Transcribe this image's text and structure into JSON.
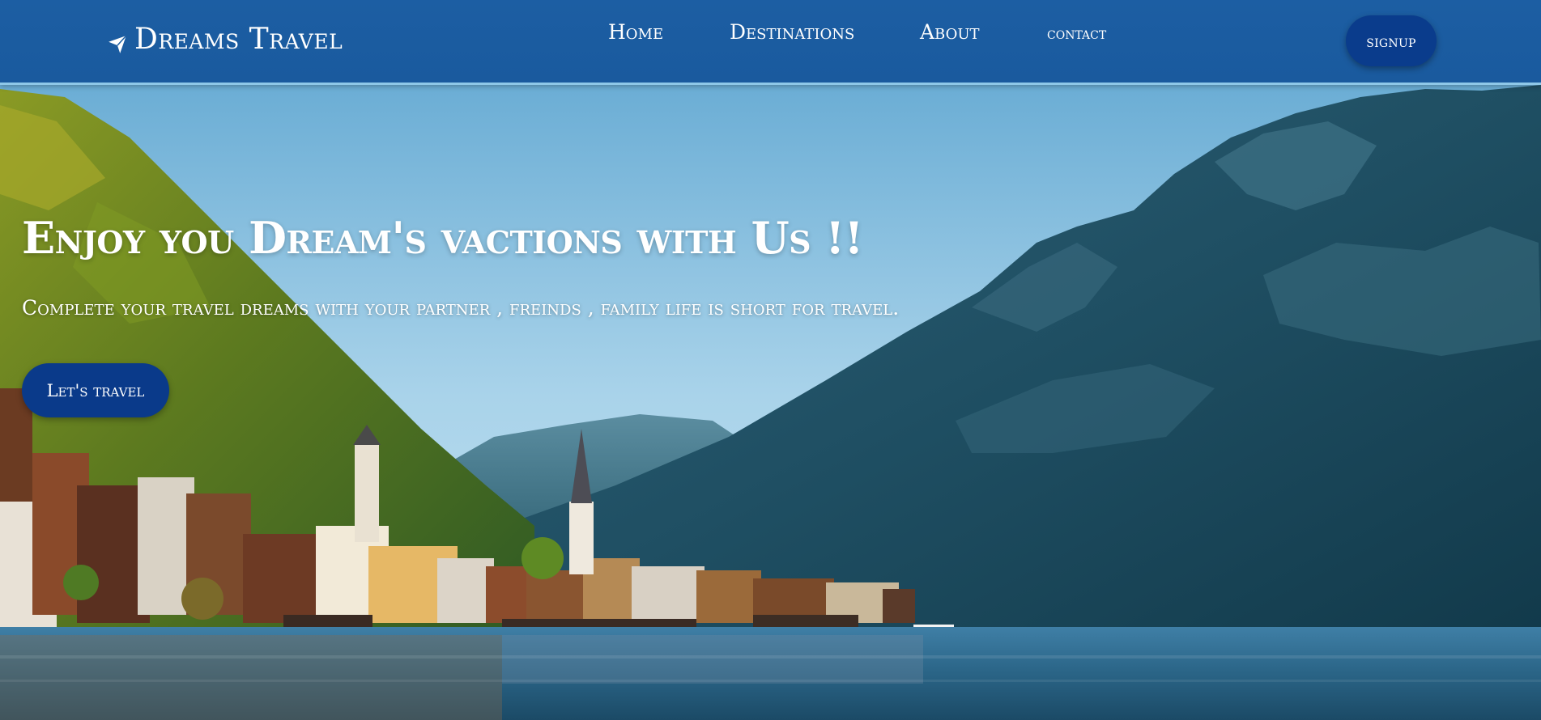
{
  "brand": {
    "name": "Dreams Travel",
    "icon": "airplane-icon"
  },
  "nav": {
    "home": "Home",
    "destinations": "Destinations",
    "about": "About",
    "contact": "contact"
  },
  "signup_label": "signup",
  "hero": {
    "headline": "Enjoy you Dream's vactions with Us !!",
    "subline": "Complete your travel dreams with your partner , freinds , family life is short for travel.",
    "cta_label": "Let's travel"
  },
  "colors": {
    "navbar": "#1c5ea3",
    "button": "#0a3c8c",
    "text": "#ffffff"
  }
}
